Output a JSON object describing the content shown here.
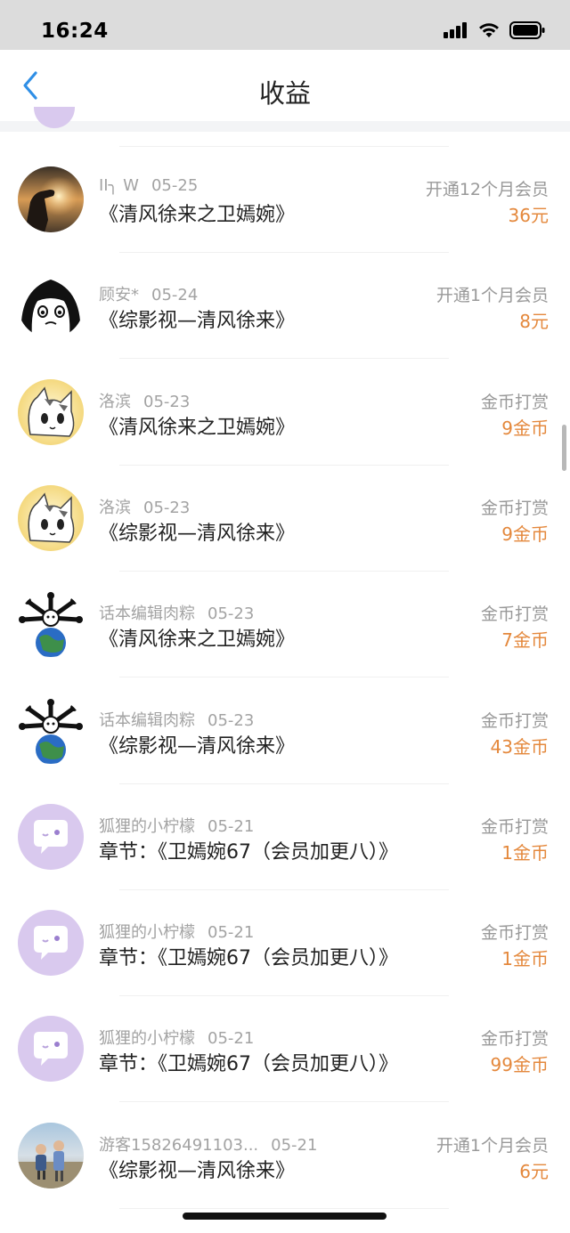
{
  "status_bar": {
    "time": "16:24"
  },
  "nav": {
    "title": "收益"
  },
  "colors": {
    "accent_blue": "#2f8fe6",
    "amount_orange": "#e4883c",
    "secondary_gray": "#a3a3a3"
  },
  "records": [
    {
      "user": "II╮ W",
      "date": "05-25",
      "title": "《清风徐来之卫嫣婉》",
      "type": "开通12个月会员",
      "amount": "36元",
      "avatar": "sunset-hand-avatar"
    },
    {
      "user": "顾安*",
      "date": "05-24",
      "title": "《综影视—清风徐来》",
      "type": "开通1个月会员",
      "amount": "8元",
      "avatar": "anime-girl-avatar"
    },
    {
      "user": "洛滨",
      "date": "05-23",
      "title": "《清风徐来之卫嫣婉》",
      "type": "金币打赏",
      "amount": "9金币",
      "avatar": "cat-avatar"
    },
    {
      "user": "洛滨",
      "date": "05-23",
      "title": "《综影视—清风徐来》",
      "type": "金币打赏",
      "amount": "9金币",
      "avatar": "cat-avatar"
    },
    {
      "user": "话本编辑肉粽",
      "date": "05-23",
      "title": "《清风徐来之卫嫣婉》",
      "type": "金币打赏",
      "amount": "7金币",
      "avatar": "bones-earth-avatar"
    },
    {
      "user": "话本编辑肉粽",
      "date": "05-23",
      "title": "《综影视—清风徐来》",
      "type": "金币打赏",
      "amount": "43金币",
      "avatar": "bones-earth-avatar"
    },
    {
      "user": "狐狸的小柠檬",
      "date": "05-21",
      "title": "章节：《卫嫣婉67（会员加更八）》",
      "type": "金币打赏",
      "amount": "1金币",
      "avatar": "chat-bubble-avatar"
    },
    {
      "user": "狐狸的小柠檬",
      "date": "05-21",
      "title": "章节：《卫嫣婉67（会员加更八）》",
      "type": "金币打赏",
      "amount": "1金币",
      "avatar": "chat-bubble-avatar"
    },
    {
      "user": "狐狸的小柠檬",
      "date": "05-21",
      "title": "章节：《卫嫣婉67（会员加更八）》",
      "type": "金币打赏",
      "amount": "99金币",
      "avatar": "chat-bubble-avatar"
    },
    {
      "user": "游客15826491103...",
      "date": "05-21",
      "title": "《综影视—清风徐来》",
      "type": "开通1个月会员",
      "amount": "6元",
      "avatar": "children-photo-avatar"
    }
  ]
}
